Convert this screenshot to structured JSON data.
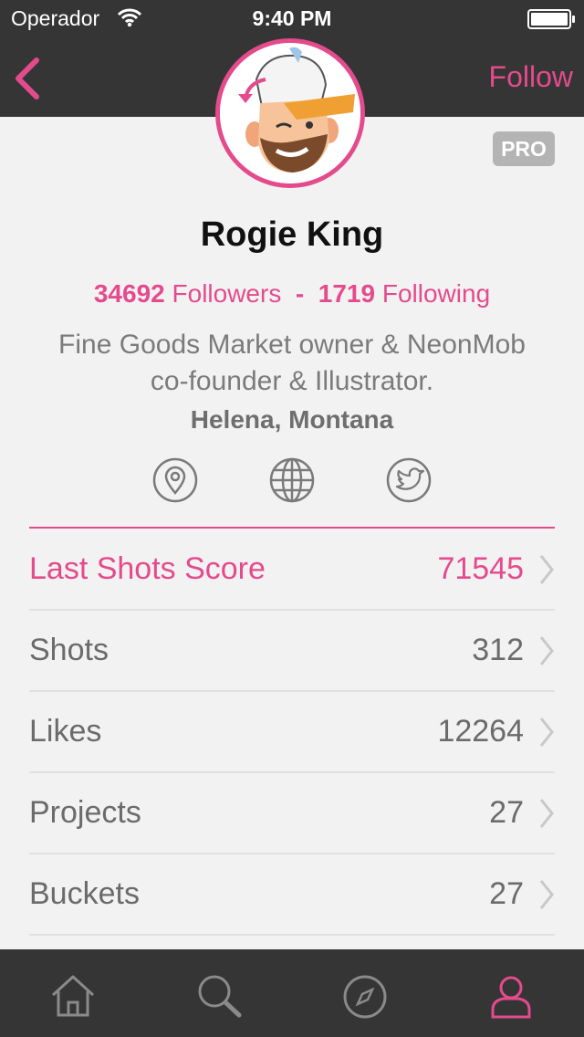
{
  "status": {
    "carrier": "Operador",
    "time": "9:40 PM"
  },
  "nav": {
    "follow_label": "Follow"
  },
  "profile": {
    "badge": "PRO",
    "name": "Rogie King",
    "followers_count": "34692",
    "followers_label": "Followers",
    "separator": "-",
    "following_count": "1719",
    "following_label": "Following",
    "bio": "Fine Goods Market owner & NeonMob co-founder & Illustrator.",
    "location": "Helena, Montana"
  },
  "rows": [
    {
      "label": "Last Shots Score",
      "value": "71545"
    },
    {
      "label": "Shots",
      "value": "312"
    },
    {
      "label": "Likes",
      "value": "12264"
    },
    {
      "label": "Projects",
      "value": "27"
    },
    {
      "label": "Buckets",
      "value": "27"
    }
  ],
  "colors": {
    "accent": "#e44b8d",
    "bar": "#353535",
    "background": "#f2f2f2"
  },
  "icons": [
    "back-chevron-icon",
    "location-pin-icon",
    "globe-icon",
    "twitter-icon",
    "home-icon",
    "search-icon",
    "compass-icon",
    "profile-icon"
  ]
}
